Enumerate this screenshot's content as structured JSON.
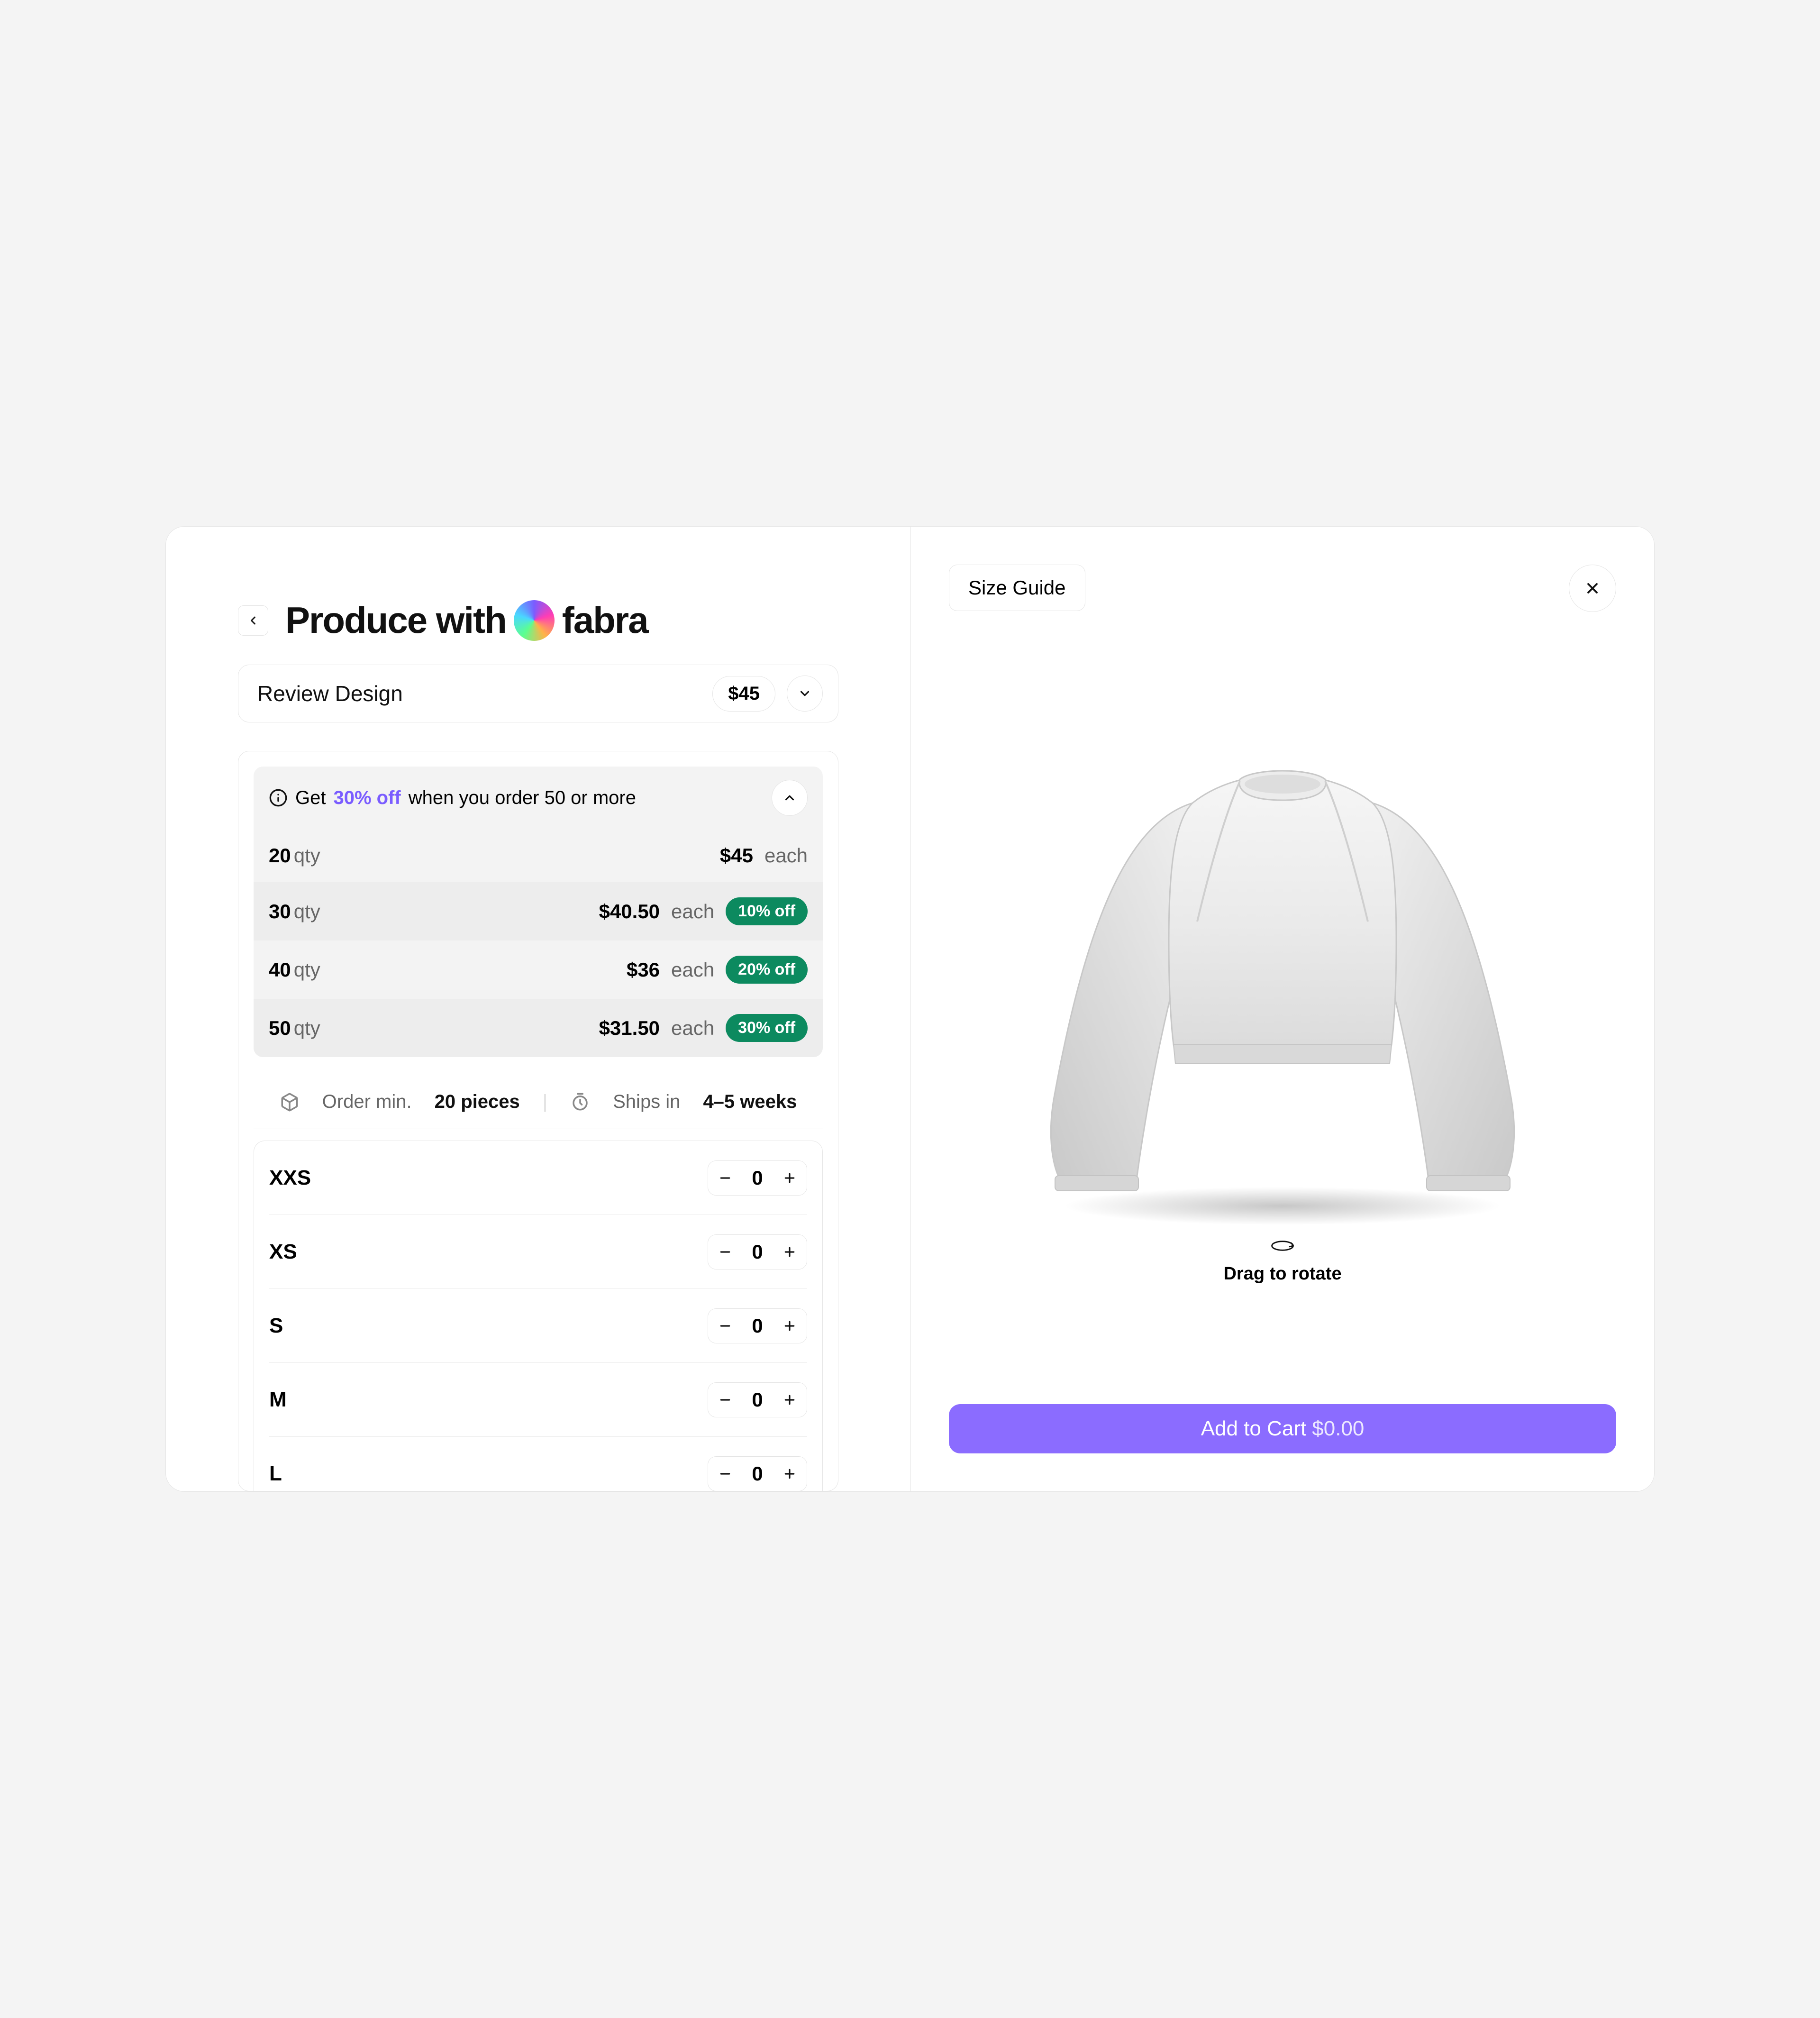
{
  "header": {
    "title_prefix": "Produce with",
    "brand": "fabra"
  },
  "review": {
    "label": "Review Design",
    "price": "$45"
  },
  "discount": {
    "headline_get": "Get",
    "headline_pct": "30% off",
    "headline_rest": "when you order 50 or more",
    "rows": [
      {
        "qty": "20",
        "qtylbl": "qty",
        "price": "$45",
        "each": "each",
        "badge": ""
      },
      {
        "qty": "30",
        "qtylbl": "qty",
        "price": "$40.50",
        "each": "each",
        "badge": "10% off"
      },
      {
        "qty": "40",
        "qtylbl": "qty",
        "price": "$36",
        "each": "each",
        "badge": "20% off"
      },
      {
        "qty": "50",
        "qtylbl": "qty",
        "price": "$31.50",
        "each": "each",
        "badge": "30% off"
      }
    ]
  },
  "meta": {
    "order_min_label": "Order min.",
    "order_min_value": "20 pieces",
    "ships_label": "Ships in",
    "ships_value": "4–5 weeks"
  },
  "sizes": [
    {
      "label": "XXS",
      "value": "0"
    },
    {
      "label": "XS",
      "value": "0"
    },
    {
      "label": "S",
      "value": "0"
    },
    {
      "label": "M",
      "value": "0"
    },
    {
      "label": "L",
      "value": "0"
    }
  ],
  "right": {
    "size_guide": "Size Guide",
    "rotate_hint": "Drag to rotate",
    "add_to_cart": "Add to Cart",
    "cart_total": "$0.00"
  }
}
